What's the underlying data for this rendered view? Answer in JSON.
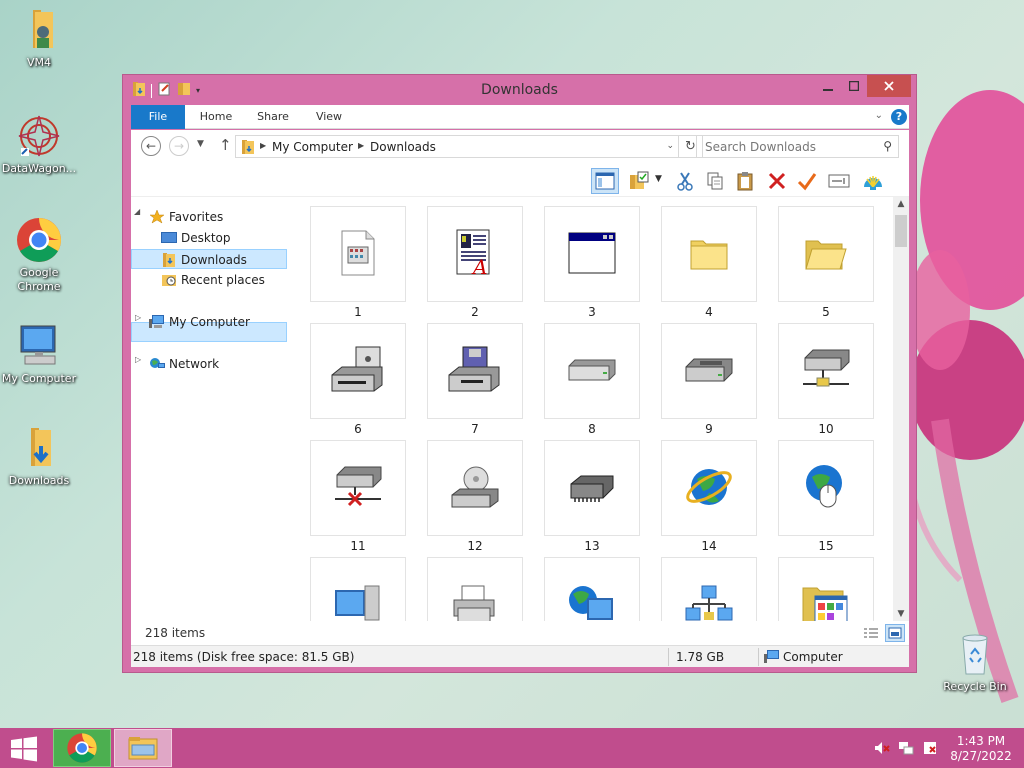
{
  "desktop": {
    "icons": [
      {
        "label": "VM4",
        "icon": "user-folder-icon"
      },
      {
        "label": "DataWagon...",
        "icon": "datawagon-app-icon"
      },
      {
        "label": "Google Chrome",
        "icon": "chrome-icon"
      },
      {
        "label": "My Computer",
        "icon": "my-computer-icon"
      },
      {
        "label": "Downloads",
        "icon": "downloads-folder-icon"
      },
      {
        "label": "Recycle Bin",
        "icon": "recycle-bin-icon"
      }
    ]
  },
  "window": {
    "title": "Downloads",
    "ribbon_tabs": [
      "File",
      "Home",
      "Share",
      "View"
    ],
    "help": "?",
    "address": {
      "crumbs": [
        "My Computer",
        "Downloads"
      ]
    },
    "search": {
      "placeholder": "Search Downloads"
    },
    "toolbar": {
      "buttons": [
        "preview-pane-icon",
        "properties-icon",
        "cut-icon",
        "copy-icon",
        "paste-icon",
        "delete-icon",
        "checkmark-icon",
        "rename-icon",
        "shell-icon"
      ]
    },
    "nav_pane": {
      "favorites": {
        "label": "Favorites",
        "items": [
          "Desktop",
          "Downloads",
          "Recent places"
        ],
        "selected": "Downloads"
      },
      "my_computer": "My Computer",
      "network": "Network"
    },
    "tiles": [
      {
        "label": "1",
        "icon": "document-icon"
      },
      {
        "label": "2",
        "icon": "text-document-icon"
      },
      {
        "label": "3",
        "icon": "window-app-icon"
      },
      {
        "label": "4",
        "icon": "folder-icon"
      },
      {
        "label": "5",
        "icon": "open-folder-icon"
      },
      {
        "label": "6",
        "icon": "drive-disk-icon"
      },
      {
        "label": "7",
        "icon": "floppy-drive-icon"
      },
      {
        "label": "8",
        "icon": "drive-icon"
      },
      {
        "label": "9",
        "icon": "hard-drive-icon"
      },
      {
        "label": "10",
        "icon": "network-drive-icon"
      },
      {
        "label": "11",
        "icon": "disconnected-drive-icon"
      },
      {
        "label": "12",
        "icon": "cd-drive-icon"
      },
      {
        "label": "13",
        "icon": "memory-chip-icon"
      },
      {
        "label": "14",
        "icon": "internet-explorer-icon"
      },
      {
        "label": "15",
        "icon": "globe-mouse-icon"
      },
      {
        "label": "",
        "icon": "computer-icon"
      },
      {
        "label": "",
        "icon": "printer-icon"
      },
      {
        "label": "",
        "icon": "network-computer-icon"
      },
      {
        "label": "",
        "icon": "network-icon"
      },
      {
        "label": "",
        "icon": "control-panel-folder-icon"
      }
    ],
    "item_count": "218 items",
    "status": {
      "summary": "218 items (Disk free space: 81.5 GB)",
      "size": "1.78 GB",
      "location": "Computer"
    }
  },
  "taskbar": {
    "apps": [
      "chrome-icon",
      "file-explorer-icon"
    ],
    "tray": [
      "volume-muted-icon",
      "network-icon",
      "action-center-icon"
    ],
    "time": "1:43 PM",
    "date": "8/27/2022"
  }
}
